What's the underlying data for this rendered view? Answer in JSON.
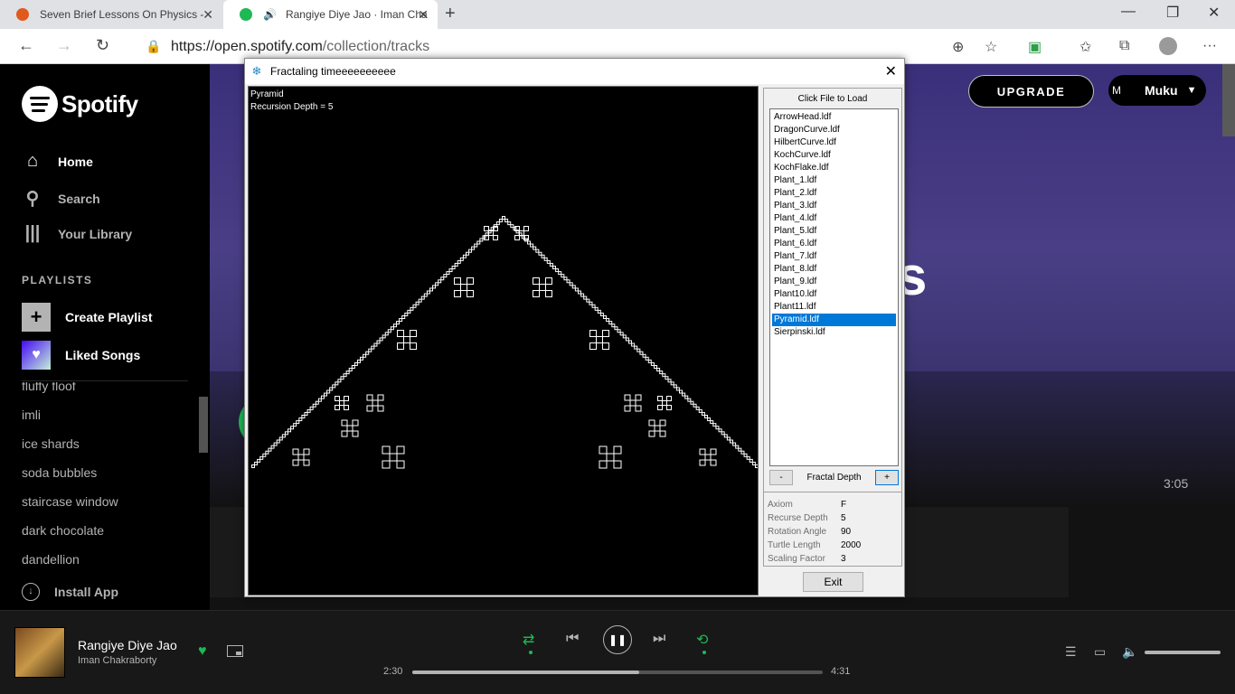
{
  "browser": {
    "tabs": [
      {
        "title": "Seven Brief Lessons On Physics -",
        "favicon_color": "#e05a1e"
      },
      {
        "title": "Rangiye Diye Jao · Iman Cha",
        "favicon_color": "#1db954"
      }
    ],
    "url": {
      "host": "https://open.spotify.com",
      "path": "/collection/tracks"
    }
  },
  "sidebar": {
    "brand": "Spotify",
    "nav": [
      {
        "label": "Home",
        "icon": "home-icon"
      },
      {
        "label": "Search",
        "icon": "search-icon"
      },
      {
        "label": "Your Library",
        "icon": "library-icon"
      }
    ],
    "playlists_heading": "PLAYLISTS",
    "create_playlist": "Create Playlist",
    "liked_songs": "Liked Songs",
    "playlists": [
      "fluffy floof",
      "imli",
      "ice shards",
      "soda bubbles",
      "staircase window",
      "dark chocolate",
      "dandellion"
    ],
    "install_app": "Install App"
  },
  "header": {
    "upgrade": "UPGRADE",
    "avatar_alt": "M",
    "user": "Muku"
  },
  "main": {
    "duration": "3:05",
    "hero_partial": "s"
  },
  "player": {
    "title": "Rangiye Diye Jao",
    "artist": "Iman Chakraborty",
    "current": "2:30",
    "total": "4:31",
    "progress": 0.553,
    "volume": 1.0,
    "accent": "#1db954"
  },
  "dialog": {
    "title": "Fractaling timeeeeeeeeee",
    "canvas_info": {
      "name": "Pyramid",
      "depth_text": "Recursion Depth = 5"
    },
    "load_label": "Click File to Load",
    "files": [
      "ArrowHead.ldf",
      "DragonCurve.ldf",
      "HilbertCurve.ldf",
      "KochCurve.ldf",
      "KochFlake.ldf",
      "Plant_1.ldf",
      "Plant_2.ldf",
      "Plant_3.ldf",
      "Plant_4.ldf",
      "Plant_5.ldf",
      "Plant_6.ldf",
      "Plant_7.ldf",
      "Plant_8.ldf",
      "Plant_9.ldf",
      "Plant10.ldf",
      "Plant11.ldf",
      "Pyramid.ldf",
      "Sierpinski.ldf"
    ],
    "selected_file": "Pyramid.ldf",
    "depth_minus": "-",
    "depth_plus": "+",
    "depth_label": "Fractal Depth",
    "props": [
      {
        "key": "Axiom",
        "value": "F"
      },
      {
        "key": "Recurse Depth",
        "value": "5"
      },
      {
        "key": "Rotation Angle",
        "value": "90"
      },
      {
        "key": "Turtle Length",
        "value": "2000"
      },
      {
        "key": "Scaling Factor",
        "value": "3"
      }
    ],
    "exit": "Exit"
  }
}
